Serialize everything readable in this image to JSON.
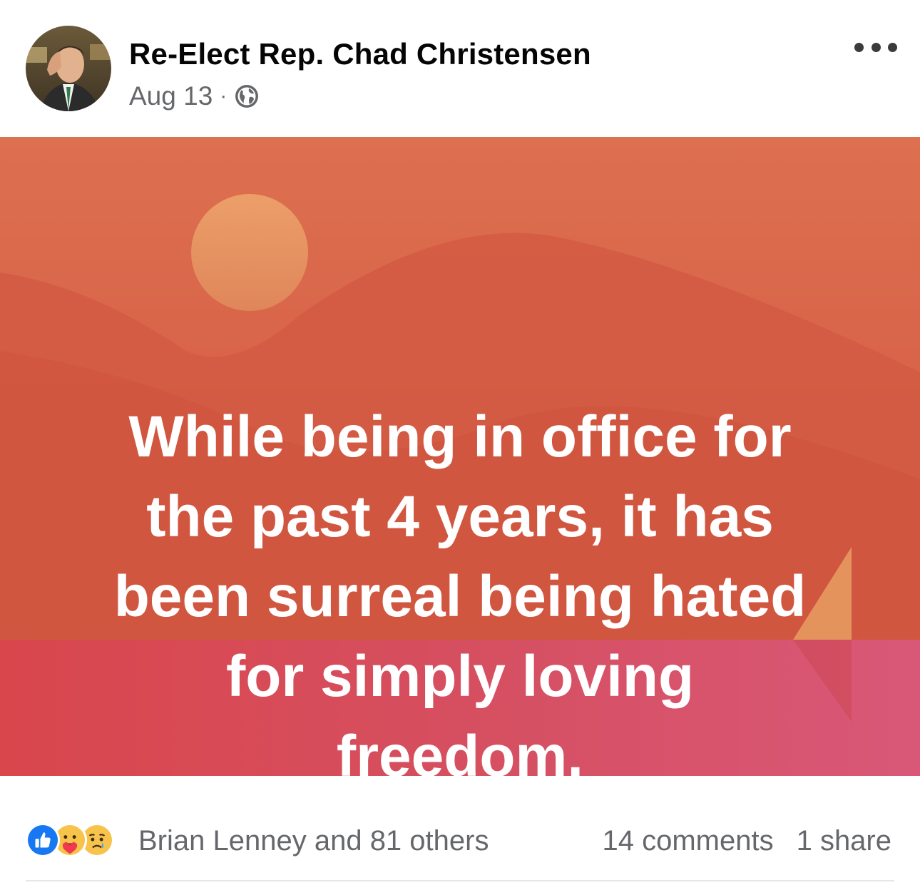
{
  "post": {
    "author": "Re-Elect Rep. Chad Christensen",
    "date": "Aug 13",
    "separator": "·",
    "audience_icon": "globe-icon",
    "more_icon": "more-options-icon"
  },
  "card": {
    "lines": [
      "While being in office for",
      "the past 4 years, it has",
      "been surreal being hated",
      "for simply loving",
      "freedom."
    ],
    "background_top": "#d9604a",
    "background_bottom": "#d84f6c",
    "text_color": "#ffffff"
  },
  "footer": {
    "reaction_icons": [
      "like-icon",
      "care-icon",
      "sad-icon"
    ],
    "reactions_text": "Brian Lenney and 81 others",
    "comments_text": "14 comments",
    "shares_text": "1 share"
  },
  "colors": {
    "secondary_text": "#65676b",
    "like_blue": "#1877f2"
  }
}
